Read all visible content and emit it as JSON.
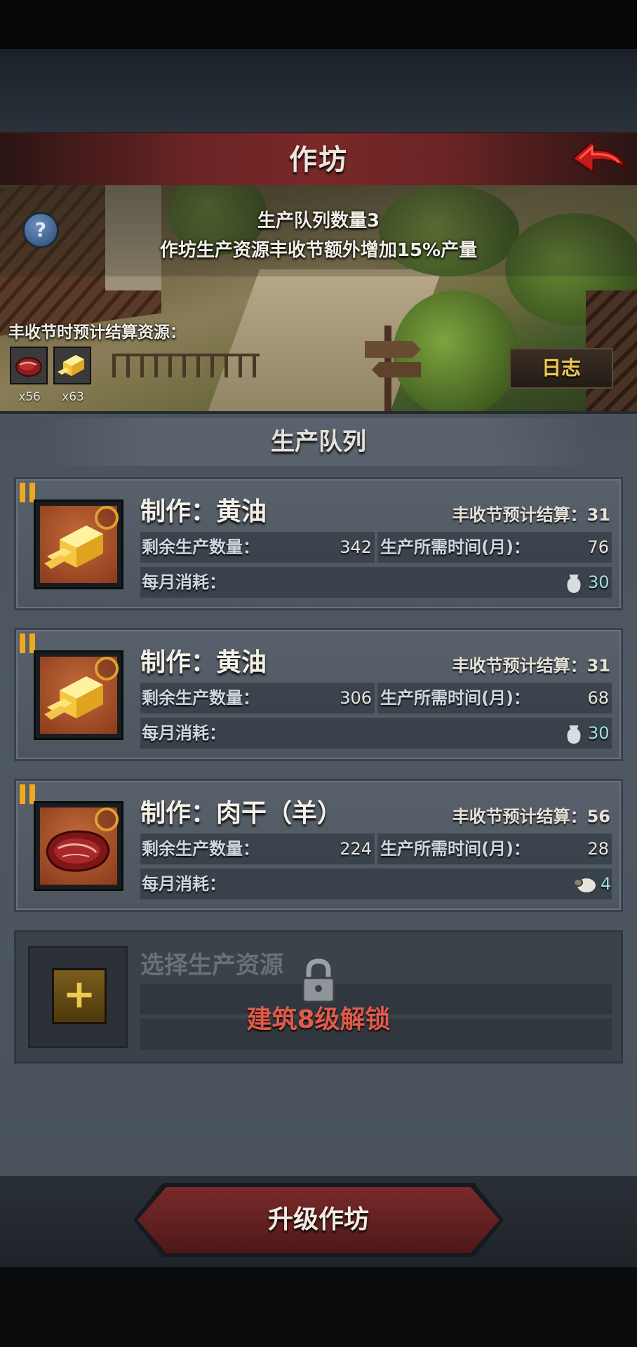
{
  "window": {
    "title": "作坊"
  },
  "banner": {
    "queue_count_line": "生产队列数量3",
    "bonus_line": "作坊生产资源丰收节额外增加15%产量",
    "help_icon": "?",
    "harvest_label": "丰收节时预计结算资源：",
    "resources": [
      {
        "icon": "meat-icon",
        "count": "x56"
      },
      {
        "icon": "butter-icon",
        "count": "x63"
      }
    ],
    "log_button": "日志"
  },
  "queue": {
    "header": "生产队列",
    "items": [
      {
        "name": "制作：黄油",
        "icon": "butter-icon",
        "settle_label": "丰收节预计结算：31",
        "remaining_label": "剩余生产数量：",
        "remaining_value": "342",
        "time_label": "生产所需时间(月)：",
        "time_value": "76",
        "consume_label": "每月消耗：",
        "consume_icon": "milk-jug-icon",
        "consume_value": "30"
      },
      {
        "name": "制作：黄油",
        "icon": "butter-icon",
        "settle_label": "丰收节预计结算：31",
        "remaining_label": "剩余生产数量：",
        "remaining_value": "306",
        "time_label": "生产所需时间(月)：",
        "time_value": "68",
        "consume_label": "每月消耗：",
        "consume_icon": "milk-jug-icon",
        "consume_value": "30"
      },
      {
        "name": "制作：肉干（羊）",
        "icon": "meat-icon",
        "settle_label": "丰收节预计结算：56",
        "remaining_label": "剩余生产数量：",
        "remaining_value": "224",
        "time_label": "生产所需时间(月)：",
        "time_value": "28",
        "consume_label": "每月消耗：",
        "consume_icon": "sheep-icon",
        "consume_value": "4"
      }
    ],
    "locked": {
      "title": "选择生产资源",
      "add_symbol": "+",
      "unlock_text": "建筑8级解锁"
    }
  },
  "footer": {
    "upgrade_button": "升级作坊"
  },
  "colors": {
    "accent_gold": "#f0a81c",
    "title_red": "#7a2828",
    "unlock_red": "#e25a4a"
  }
}
